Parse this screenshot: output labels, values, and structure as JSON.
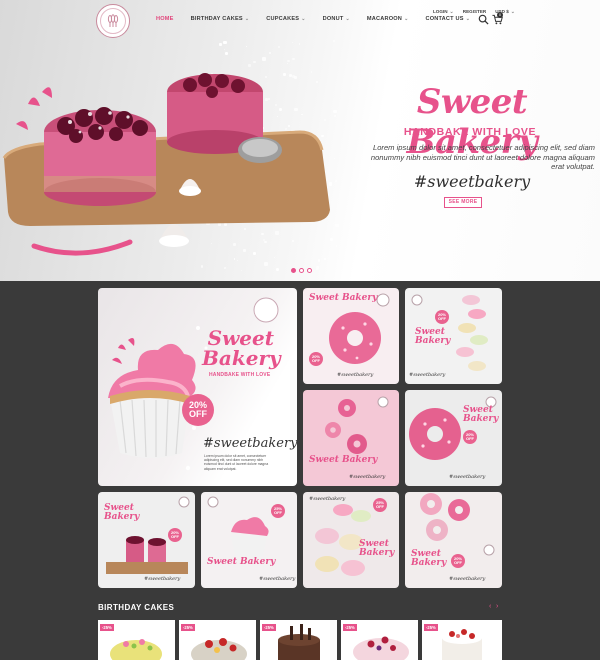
{
  "nav": {
    "items": [
      {
        "label": "HOME",
        "active": true,
        "dropdown": false
      },
      {
        "label": "BIRTHDAY CAKES",
        "active": false,
        "dropdown": true
      },
      {
        "label": "CUPCAKES",
        "active": false,
        "dropdown": true
      },
      {
        "label": "DONUT",
        "active": false,
        "dropdown": true
      },
      {
        "label": "MACAROON",
        "active": false,
        "dropdown": true
      },
      {
        "label": "CONTACT US",
        "active": false,
        "dropdown": true
      }
    ],
    "login": "LOGIN",
    "register": "REGISTER",
    "currency": "USD $",
    "cart_count": "0"
  },
  "hero": {
    "title": "Sweet Bakery",
    "subtitle": "HANDBAKE WITH LOVE",
    "body": "Lorem ipsum dolor sit amet, consectetuer adipiscing elit, sed diam nonummy nibh euismod tinci dunt ut laoreet dolore magna aliquam erat volutpat.",
    "hashtag": "#sweetbakery",
    "cta": "SEE MORE",
    "slides": 3,
    "active_slide": 1
  },
  "gallery": {
    "brand_title": "Sweet Bakery",
    "brand_sub": "HANDBAKE WITH LOVE",
    "hashtag": "#sweetbakery",
    "discount": "20%",
    "discount_word": "OFF",
    "alt_discount": "25%",
    "body": "Lorem ipsum dolor sit amet, consectetuer adipiscing elit, sed diam nonummy nibh euismod tinci dunt ut laoreet dolore magna aliquam erat volutpat."
  },
  "birthday": {
    "heading": "BIRTHDAY CAKES",
    "prev": "‹",
    "next": "›",
    "sale_tag": "-25%"
  },
  "colors": {
    "accent": "#e7528b",
    "dark_bg": "#3a3a3a"
  }
}
